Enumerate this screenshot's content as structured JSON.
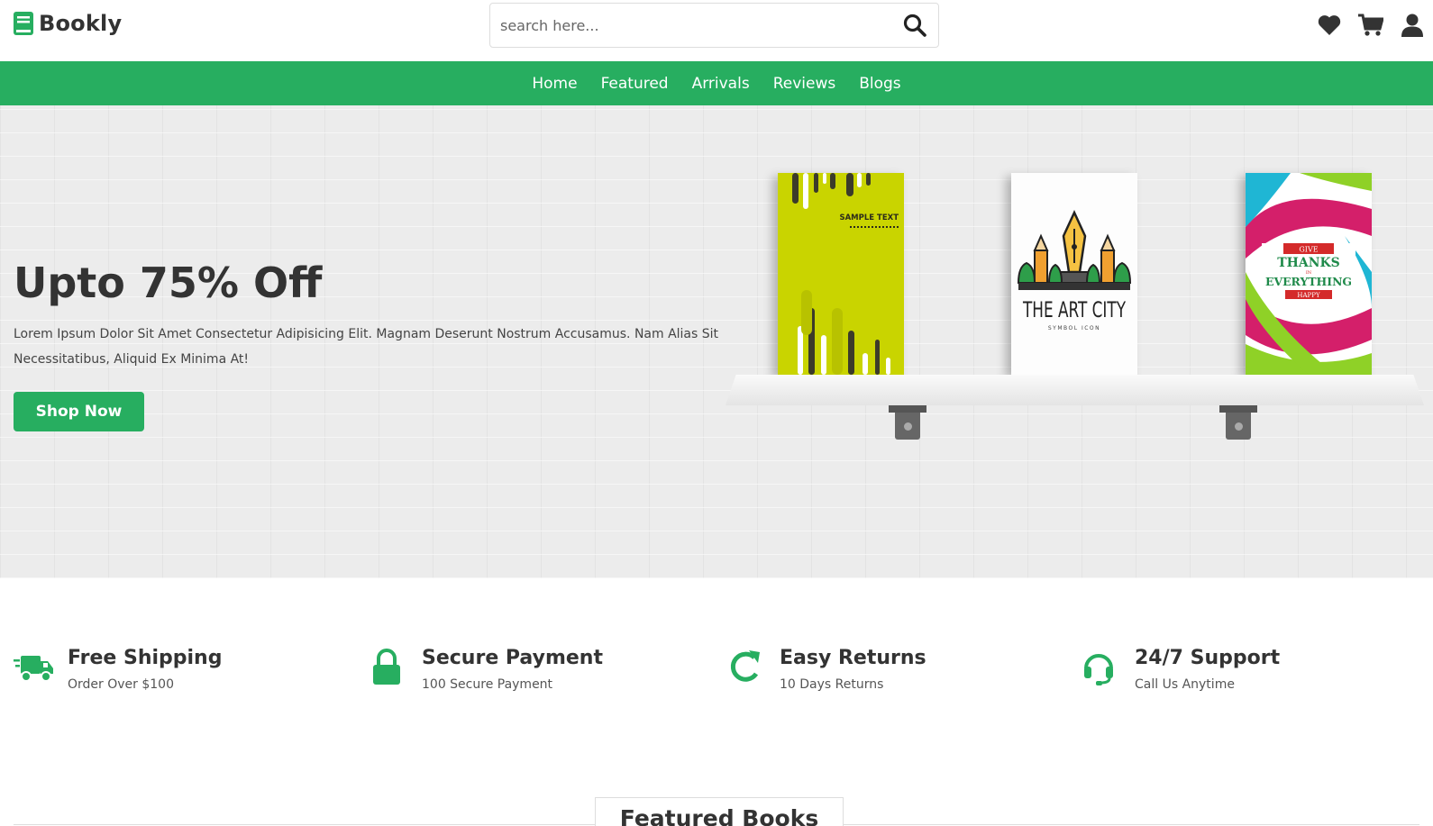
{
  "brand": {
    "name": "Bookly",
    "color": "#27ae60"
  },
  "search": {
    "placeholder": "search here..."
  },
  "nav": {
    "items": [
      "Home",
      "Featured",
      "Arrivals",
      "Reviews",
      "Blogs"
    ]
  },
  "hero": {
    "title": "Upto 75% Off",
    "description": "Lorem Ipsum Dolor Sit Amet Consectetur Adipisicing Elit. Magnam Deserunt Nostrum Accusamus. Nam Alias Sit Necessitatibus, Aliquid Ex Minima At!",
    "button_label": "Shop Now",
    "books": [
      {
        "cover_text": "SAMPLE TEXT"
      },
      {
        "cover_title": "THE ART CITY",
        "cover_subtitle": "SYMBOL ICON"
      },
      {
        "cover_lines": [
          "GIVE",
          "THANKS",
          "IN",
          "EVERYTHING",
          "HAPPY"
        ]
      }
    ]
  },
  "features": [
    {
      "icon": "truck-icon",
      "title": "Free Shipping",
      "subtitle": "Order Over $100"
    },
    {
      "icon": "lock-icon",
      "title": "Secure Payment",
      "subtitle": "100 Secure Payment"
    },
    {
      "icon": "redo-icon",
      "title": "Easy Returns",
      "subtitle": "10 Days Returns"
    },
    {
      "icon": "headset-icon",
      "title": "24/7 Support",
      "subtitle": "Call Us Anytime"
    }
  ],
  "section": {
    "title": "Featured Books"
  }
}
